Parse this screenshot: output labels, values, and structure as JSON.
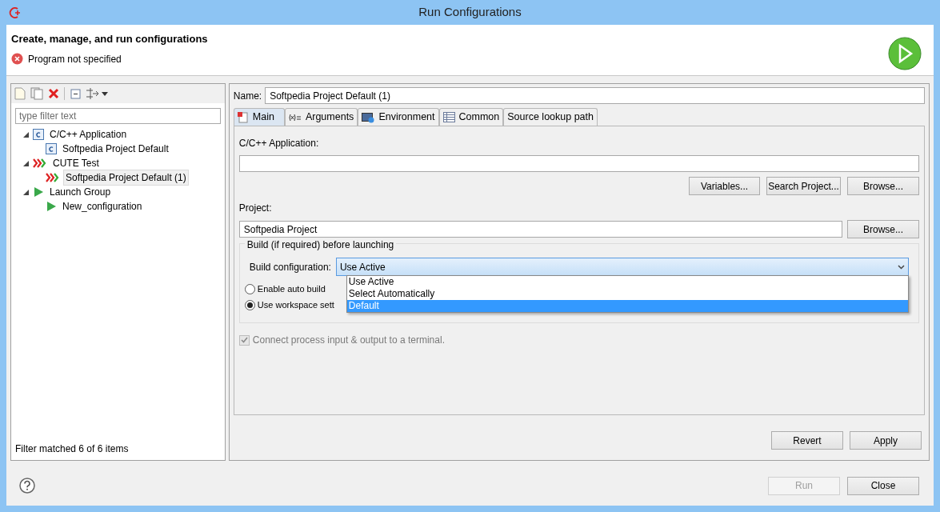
{
  "window": {
    "title": "Run Configurations"
  },
  "header": {
    "title": "Create, manage, and run configurations",
    "message": "Program not specified"
  },
  "sidebar": {
    "filter": {
      "placeholder": "type filter text"
    },
    "tree": [
      {
        "label": "C/C++ Application",
        "kind": "capp",
        "expanded": true,
        "selected": false,
        "children": [
          {
            "label": "Softpedia Project Default",
            "kind": "capp",
            "selected": false
          }
        ]
      },
      {
        "label": "CUTE Test",
        "kind": "cute",
        "expanded": true,
        "selected": false,
        "children": [
          {
            "label": "Softpedia Project Default (1)",
            "kind": "cute",
            "selected": true
          }
        ]
      },
      {
        "label": "Launch Group",
        "kind": "launch",
        "expanded": true,
        "selected": false,
        "children": [
          {
            "label": "New_configuration",
            "kind": "launch",
            "selected": false
          }
        ]
      }
    ],
    "status": "Filter matched 6 of 6 items"
  },
  "name": {
    "label": "Name:",
    "value": "Softpedia Project Default (1)"
  },
  "tabs": [
    {
      "label": "Main",
      "kind": "main",
      "selected": true
    },
    {
      "label": "Arguments",
      "kind": "args",
      "selected": false
    },
    {
      "label": "Environment",
      "kind": "env",
      "selected": false
    },
    {
      "label": "Common",
      "kind": "common",
      "selected": false
    },
    {
      "label": "Source lookup path",
      "kind": "none",
      "selected": false
    }
  ],
  "main": {
    "app_label": "C/C++ Application:",
    "app_buttons": [
      "Variables...",
      "Search Project...",
      "Browse..."
    ],
    "project_label": "Project:",
    "project_value": "Softpedia Project",
    "project_button": "Browse...",
    "build_group": "Build (if required) before launching",
    "build_label": "Build configuration:",
    "build_value": "Use Active",
    "build_options": [
      {
        "label": "Use Active",
        "selected": false
      },
      {
        "label": "Select Automatically",
        "selected": false
      },
      {
        "label": "Default",
        "selected": true
      }
    ],
    "radios": [
      {
        "label": "Enable auto build",
        "selected": false
      },
      {
        "label": "Use workspace sett",
        "selected": true
      }
    ],
    "terminal": {
      "label": "Connect process input & output to a terminal.",
      "checked": true,
      "disabled": true
    }
  },
  "actions": [
    "Revert",
    "Apply"
  ],
  "footer": {
    "run": {
      "label": "Run",
      "disabled": true
    },
    "close": {
      "label": "Close",
      "disabled": false
    }
  }
}
